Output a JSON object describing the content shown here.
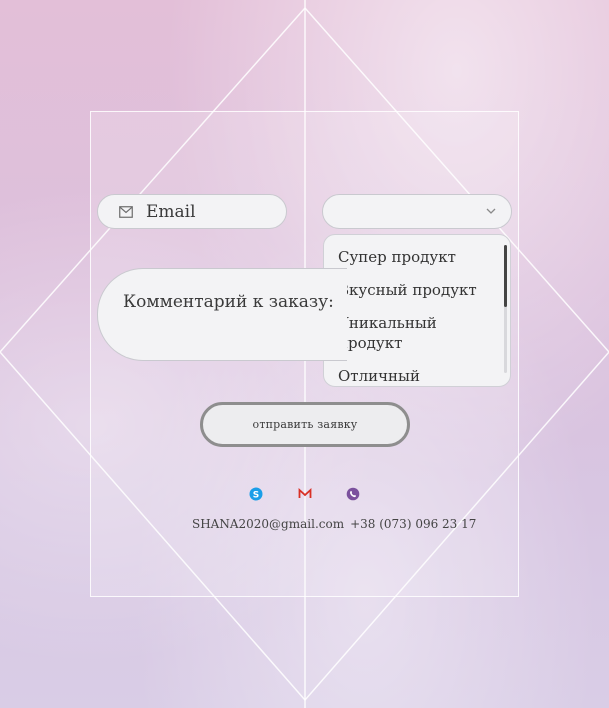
{
  "form": {
    "email_placeholder": "Email",
    "product_select_value": "",
    "comment_placeholder": "Комментарий к заказу:",
    "submit_label": "отправить заявку"
  },
  "product_options": [
    "Супер продукт",
    "Вкусный продукт",
    "Уникальный продукт",
    "Отличный продукт"
  ],
  "social": {
    "skype_color": "#1a9ee8",
    "gmail_color": "#d93025",
    "viber_color": "#7b519d"
  },
  "contacts": {
    "email": "SHANA2020@gmail.com",
    "phone": "+38 (073) 096 23 17"
  }
}
